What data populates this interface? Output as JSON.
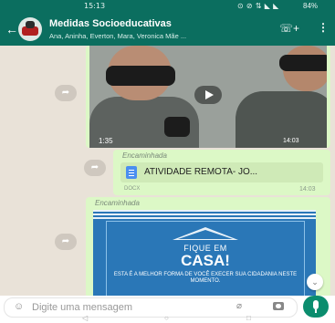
{
  "status_bar": {
    "time": "15:13",
    "left_icons": "▣ ✿ ▣",
    "right_icons": "⊙ ⊘ ⇅ ◣ ◣",
    "battery": "84%"
  },
  "app_bar": {
    "back_icon": "arrow-left",
    "title": "Medidas Socioeducativas",
    "subtitle": "Ana, Aninha, Everton, Mara, Veronica Mãe ...",
    "call_icon": "phone-plus",
    "menu_icon": "more-vertical"
  },
  "messages": [
    {
      "type": "video",
      "duration": "1:35",
      "time": "14:03"
    },
    {
      "type": "document",
      "forwarded_label": "Encaminhada",
      "filename": "ATIVIDADE REMOTA- JO...",
      "filetype": "DOCX",
      "time": "14:03"
    },
    {
      "type": "image",
      "forwarded_label": "Encaminhada",
      "poster_line1": "FIQUE EM",
      "poster_line2": "CASA!",
      "poster_line3": "ESTA É A MELHOR FORMA DE VOCÊ EXECER SUA CIDADANIA NESTE MOMENTO."
    }
  ],
  "input": {
    "placeholder": "Digite uma mensagem"
  },
  "nav": {
    "back": "◁",
    "home": "○",
    "recents": "□"
  },
  "colors": {
    "header": "#0b6e5f",
    "bubble": "#dcf8c6",
    "chat_bg": "#e9e2d8",
    "send": "#0b8d6e",
    "poster": "#2a77b7"
  }
}
